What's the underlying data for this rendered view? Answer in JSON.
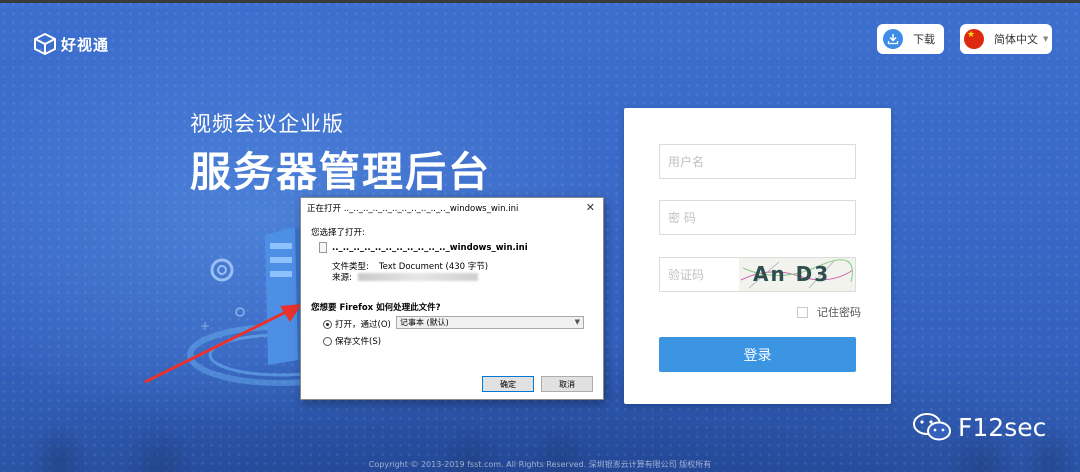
{
  "app": {
    "logo_text": "好视通"
  },
  "header": {
    "download_label": "下载",
    "language_label": "简体中文"
  },
  "hero": {
    "subtitle": "视频会议企业版",
    "title": "服务器管理后台"
  },
  "login": {
    "username_placeholder": "用户名",
    "password_placeholder": "密 码",
    "captcha_placeholder": "验证码",
    "captcha_text": "An D3",
    "remember_label": "记住密码",
    "submit_label": "登录"
  },
  "dialog": {
    "title": "正在打开 .._.._.._.._.._.._.._.._.._.._.._windows_win.ini",
    "selected_label": "您选择了打开:",
    "file_name": ".._.._.._.._.._.._.._.._.._.._.._windows_win.ini",
    "file_type_label": "文件类型:",
    "file_type_value": "Text Document (430 字节)",
    "source_label": "来源:",
    "question": "您想要 Firefox 如何处理此文件?",
    "open_with_label": "打开，通过(O)",
    "app_option": "记事本 (默认)",
    "save_label": "保存文件(S)",
    "ok_label": "确定",
    "cancel_label": "取消"
  },
  "watermark": {
    "text": "F12sec"
  },
  "footer": {
    "copyright": "Copyright © 2013-2019 fsst.com. All Rights Reserved. 深圳银澎云计算有限公司 版权所有"
  },
  "colors": {
    "background": "#3a69c8",
    "login_button": "#3b95e3",
    "download_icon": "#3e8ce8",
    "arrow": "#e8322e"
  }
}
